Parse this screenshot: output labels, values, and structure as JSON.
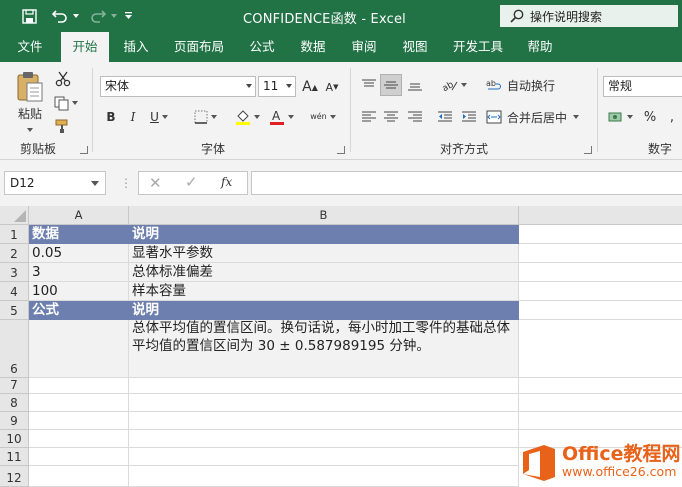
{
  "titlebar": {
    "title": "CONFIDENCE函数  -  Excel",
    "search_placeholder": "操作说明搜索"
  },
  "tabs": [
    "文件",
    "开始",
    "插入",
    "页面布局",
    "公式",
    "数据",
    "审阅",
    "视图",
    "开发工具",
    "帮助"
  ],
  "active_tab": "开始",
  "ribbon": {
    "clipboard": {
      "paste_label": "粘贴",
      "group_label": "剪贴板"
    },
    "font": {
      "font_name": "宋体",
      "font_size": "11",
      "group_label": "字体",
      "grow": "A",
      "shrink": "A",
      "bold": "B",
      "italic": "I",
      "underline": "U",
      "phonetic": "wén"
    },
    "alignment": {
      "wrap_text": "自动换行",
      "merge_center": "合并后居中",
      "group_label": "对齐方式"
    },
    "number": {
      "format": "常规",
      "percent": "%",
      "group_label": "数字"
    }
  },
  "formula_bar": {
    "name_box": "D12",
    "fx": "fx",
    "formula": ""
  },
  "columns": [
    "A",
    "B"
  ],
  "rows": [
    "1",
    "2",
    "3",
    "4",
    "5",
    "6",
    "7",
    "8",
    "9",
    "10",
    "11",
    "12"
  ],
  "sheet": {
    "r1": {
      "a": "数据",
      "b": "说明"
    },
    "r2": {
      "a": "0.05",
      "b": "显著水平参数"
    },
    "r3": {
      "a": "3",
      "b": "总体标准偏差"
    },
    "r4": {
      "a": "100",
      "b": "样本容量"
    },
    "r5": {
      "a": "公式",
      "b": "说明"
    },
    "r6": {
      "a": "",
      "b": "总体平均值的置信区间。换句话说，每小时加工零件的基础总体平均值的置信区间为 30 ± 0.587989195 分钟。"
    }
  },
  "colors": {
    "excel_green": "#217346",
    "header_fill": "#6d7fae",
    "data_fill": "#f2f2f2",
    "watermark": "#e8621a"
  },
  "watermark": {
    "brand": "Office教程网",
    "url": "www.office26.com"
  }
}
